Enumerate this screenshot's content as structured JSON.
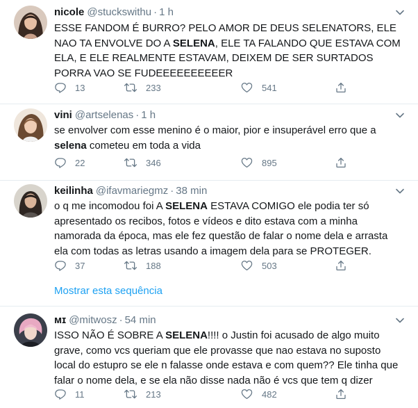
{
  "tweets": [
    {
      "name": "nicole",
      "handle": "@stuckswithu",
      "dot": "·",
      "time": "1 h",
      "text_parts": [
        "ESSE FANDOM É BURRO? PELO AMOR DE DEUS SELENATORS, ELE NAO TA ENVOLVE DO A ",
        "SELENA",
        ", ELE TA FALANDO QUE ESTAVA COM ELA, E ELE REALMENTE ESTAVAM, DEIXEM DE SER SURTADOS PORRA VAO SE FUDEEEEEEEEEER"
      ],
      "replies": "13",
      "retweets": "233",
      "likes": "541"
    },
    {
      "name": "vini",
      "handle": "@artselenas",
      "dot": "·",
      "time": "1 h",
      "text_parts": [
        "se envolver com esse menino é o maior, pior e insuperável erro que a ",
        "selena",
        " cometeu em toda a vida"
      ],
      "replies": "22",
      "retweets": "346",
      "likes": "895"
    },
    {
      "name": "keilinha",
      "handle": "@ifavmariegmz",
      "dot": "·",
      "time": "38 min",
      "text_parts": [
        "o q me incomodou foi A ",
        "SELENA",
        " ESTAVA COMIGO ele podia ter só apresentado os recibos, fotos e vídeos e dito estava com a minha namorada da época, mas ele fez questão de falar o nome dela e arrasta ela com todas as letras usando a imagem dela para se PROTEGER."
      ],
      "replies": "37",
      "retweets": "188",
      "likes": "503"
    },
    {
      "name": "ᴍɪ",
      "handle": "@mitwosz",
      "dot": "·",
      "time": "54 min",
      "text_parts": [
        "ISSO NÃO É SOBRE A ",
        "SELENA",
        "!!!! o Justin foi acusado de algo muito grave, como vcs queriam que ele provasse que nao estava no suposto local do estupro se ele n falasse onde estava e com quem?? Ele tinha que falar o nome dela, e se ela não disse nada não é vcs que tem q dizer"
      ],
      "replies": "11",
      "retweets": "213",
      "likes": "482"
    }
  ],
  "show_thread_label": "Mostrar esta sequência",
  "colors": {
    "text": "#14171a",
    "muted": "#657786",
    "link": "#1da1f2",
    "border": "#e6ecf0"
  },
  "icons": [
    "reply-icon",
    "retweet-icon",
    "like-icon",
    "share-icon",
    "caret-down-icon"
  ]
}
